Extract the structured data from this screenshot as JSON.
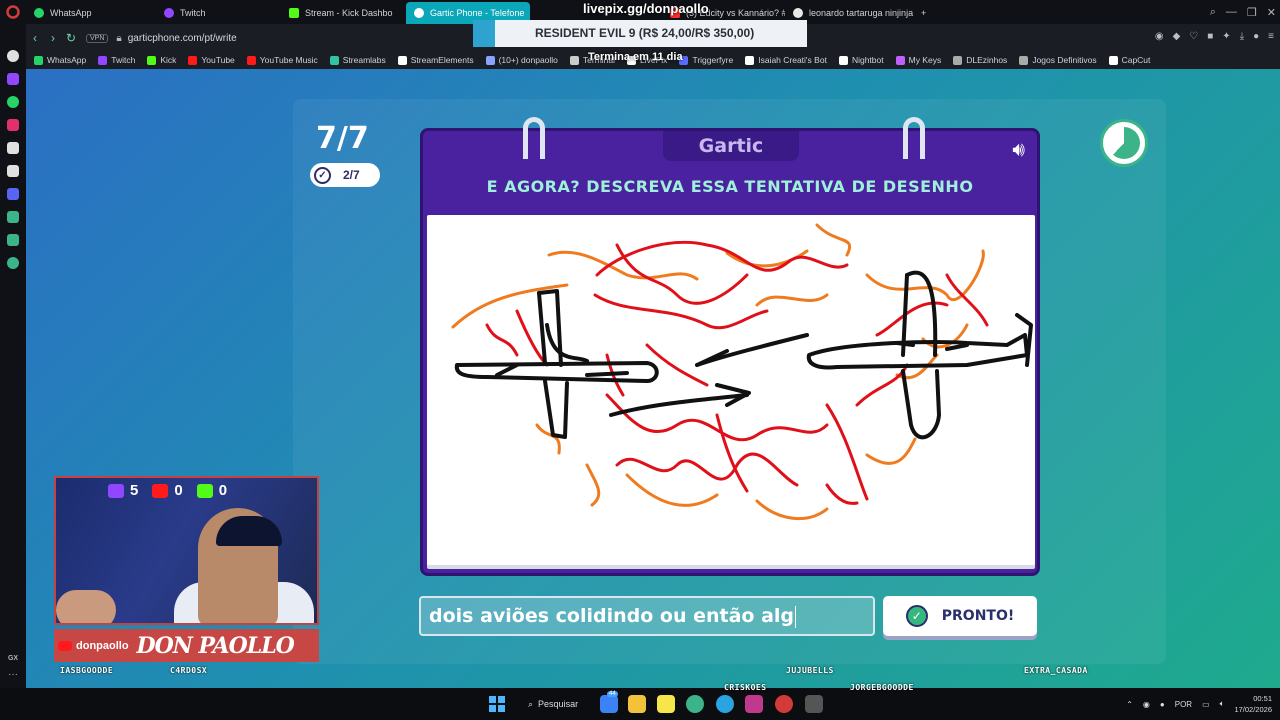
{
  "browser": {
    "tabs": [
      {
        "label": "WhatsApp",
        "color": "#25d366"
      },
      {
        "label": "Twitch",
        "color": "#9146ff"
      },
      {
        "label": "Stream - Kick Dashbo",
        "color": "#53fc18"
      },
      {
        "label": "Gartic Phone - Telefone",
        "color": "#ffffff",
        "active": true
      },
      {
        "label": "(3) Edcity vs Kannário? #s",
        "color": "#ff2d2d"
      },
      {
        "label": "leonardo tartaruga ninjinja",
        "color": "#e8e8e8"
      }
    ],
    "new_tab": "+",
    "address": "garticphone.com/pt/write",
    "vpn": "VPN",
    "bookmarks": [
      {
        "label": "WhatsApp",
        "color": "#25d366"
      },
      {
        "label": "Twitch",
        "color": "#9146ff"
      },
      {
        "label": "Kick",
        "color": "#53fc18"
      },
      {
        "label": "YouTube",
        "color": "#ff1b1b"
      },
      {
        "label": "YouTube Music",
        "color": "#ff1b1b"
      },
      {
        "label": "Streamlabs",
        "color": "#31c3a2"
      },
      {
        "label": "StreamElements",
        "color": "#ffffff"
      },
      {
        "label": "(10+) donpaollo",
        "color": "#8aa3ff"
      },
      {
        "label": "Terminal",
        "color": "#cccccc"
      },
      {
        "label": "LivePix",
        "color": "#ffffff"
      },
      {
        "label": "Triggerfyre",
        "color": "#5b6cff"
      },
      {
        "label": "Isaiah Creati's Bot",
        "color": "#ffffff"
      },
      {
        "label": "Nightbot",
        "color": "#ffffff"
      },
      {
        "label": "My Keys",
        "color": "#c060ff"
      },
      {
        "label": "DLEzinhos",
        "color": "#aaaaaa"
      },
      {
        "label": "Jogos Definitivos",
        "color": "#aaaaaa"
      },
      {
        "label": "CapCut",
        "color": "#ffffff"
      }
    ]
  },
  "overlay": {
    "livepix": "livepix.gg/donpaollo",
    "goal": "RESIDENT EVIL 9 (R$ 24,00/R$ 350,00)",
    "ends": "Termina em 11 dia"
  },
  "game": {
    "round": "7/7",
    "done": "2/7",
    "brand": "Gartic",
    "prompt": "E AGORA? DESCREVA ESSA TENTATIVA DE DESENHO",
    "answer": "dois aviões colidindo ou então alg",
    "submit": "PRONTO!",
    "timer_fraction": 0.62,
    "colors": {
      "panel": "#4a22a0",
      "accent": "#9ff0d8",
      "red": "#e0101a",
      "orange": "#f07a1e"
    }
  },
  "stream": {
    "twitch_count": "5",
    "youtube_count": "0",
    "kick_count": "0",
    "handle": "donpaollo",
    "title": "DON PAOLLO"
  },
  "viewers": [
    "IASBGOODDE",
    "C4RD0SX",
    "JUJUBELLS",
    "EXTRA_CASADA",
    "CRISKOES",
    "JORGEBGOODDE"
  ],
  "taskbar": {
    "search": "Pesquisar",
    "badge": "44",
    "lang": "POR",
    "time": "00:51",
    "date": "17/02/2026"
  }
}
